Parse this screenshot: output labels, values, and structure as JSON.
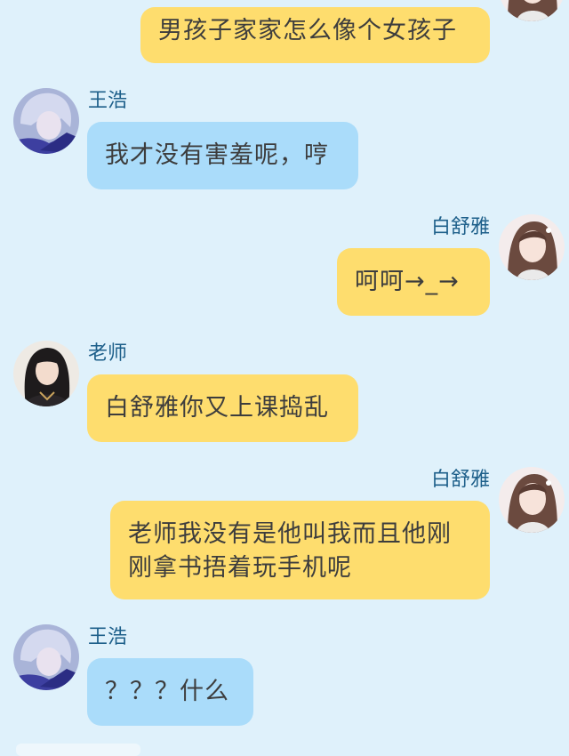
{
  "messages": [
    {
      "sender": "",
      "side": "right",
      "color": "yellow",
      "avatar": "girl-avatar",
      "text": "男孩子家家怎么像个女孩子"
    },
    {
      "sender": "王浩",
      "side": "left",
      "color": "blue",
      "avatar": "boy-avatar",
      "text": "我才没有害羞呢，哼"
    },
    {
      "sender": "白舒雅",
      "side": "right",
      "color": "yellow",
      "avatar": "girl-avatar",
      "text": "呵呵→_→"
    },
    {
      "sender": "老师",
      "side": "left",
      "color": "yellow",
      "avatar": "teacher-avatar",
      "text": "白舒雅你又上课捣乱"
    },
    {
      "sender": "白舒雅",
      "side": "right",
      "color": "yellow",
      "avatar": "girl-avatar",
      "text_lines": [
        "老师我没有是他叫我而且他刚",
        "刚拿书捂着玩手机呢"
      ]
    },
    {
      "sender": "王浩",
      "side": "left",
      "color": "blue",
      "avatar": "boy-avatar",
      "text": "？？？什么"
    }
  ],
  "colors": {
    "background": "#dff1fb",
    "yellow_bubble": "#fedd6e",
    "blue_bubble": "#aadcfa",
    "name_text": "#1d5f8a"
  }
}
